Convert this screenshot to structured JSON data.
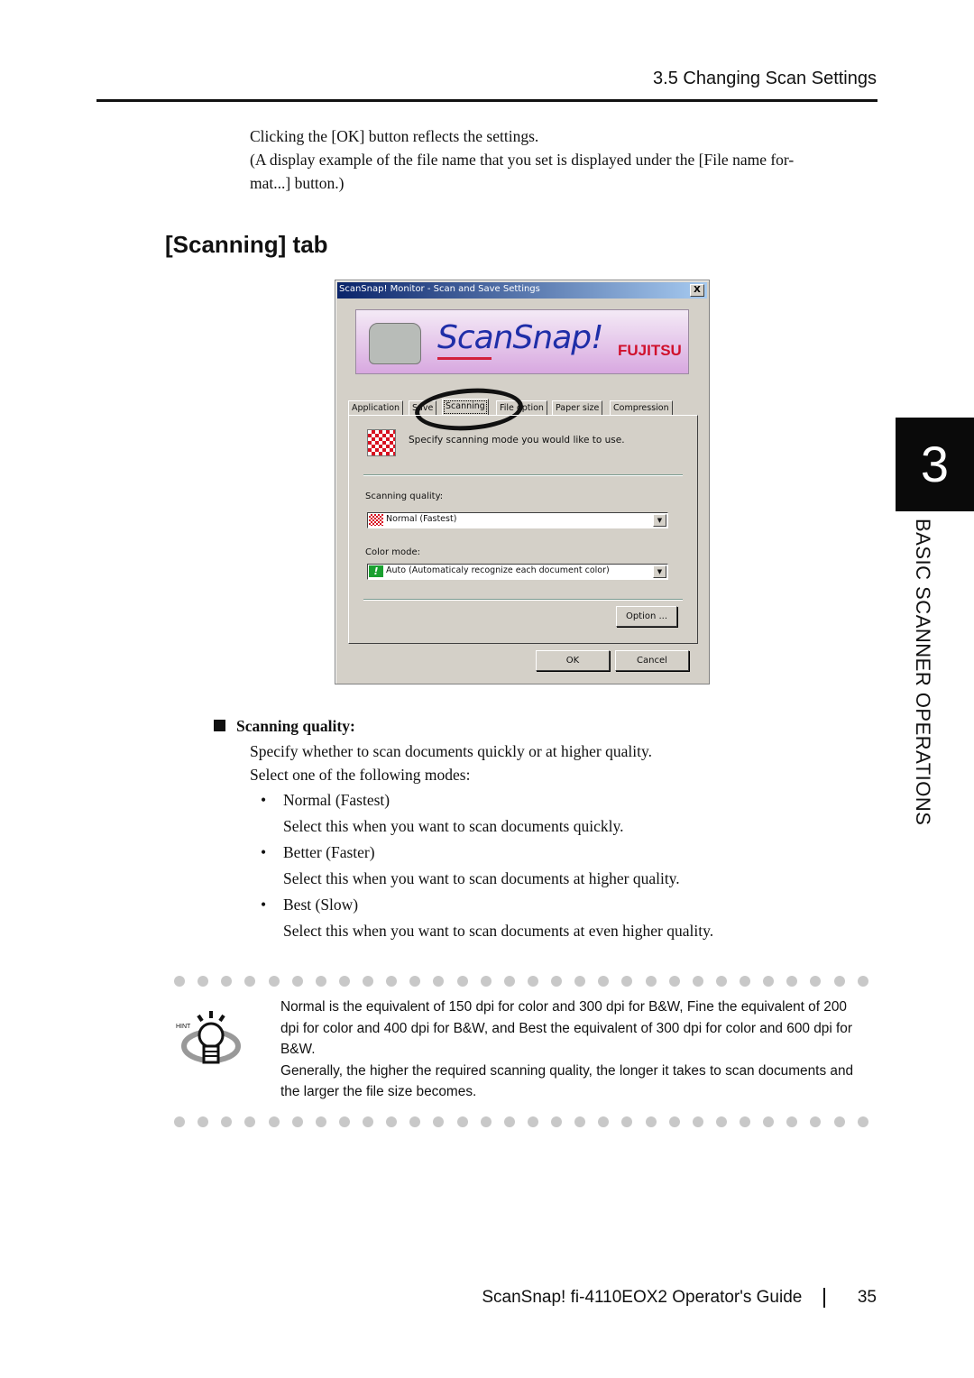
{
  "header": {
    "section_title": "3.5 Changing Scan Settings"
  },
  "intro": {
    "line1": "Clicking the [OK] button reflects the settings.",
    "line2": "(A display example of the file name that you set is displayed under the [File name for-",
    "line3": "mat...] button.)"
  },
  "section_heading": "[Scanning] tab",
  "dialog": {
    "title": "ScanSnap! Monitor - Scan and Save Settings",
    "close_label": "X",
    "banner_logo": "ScanSnap!",
    "banner_brand": "FUJITSU",
    "tabs": [
      {
        "label": "Application"
      },
      {
        "label": "Save"
      },
      {
        "label": "Scanning",
        "active": true
      },
      {
        "label": "File option"
      },
      {
        "label": "Paper size"
      },
      {
        "label": "Compression"
      }
    ],
    "panel_hint": "Specify scanning mode you would like to use.",
    "scanning_quality_label": "Scanning quality:",
    "scanning_quality_value": "Normal (Fastest)",
    "color_mode_label": "Color mode:",
    "color_mode_value": "Auto (Automaticaly recognize each document color)",
    "option_button": "Option ...",
    "ok_button": "OK",
    "cancel_button": "Cancel",
    "colors": {
      "titlebar_start": "#0a246a",
      "titlebar_end": "#a6caf0",
      "face": "#d4d0c8"
    }
  },
  "scanning_quality": {
    "heading": "Scanning quality:",
    "desc1": "Specify whether to scan documents quickly or at higher quality.",
    "desc2": "Select one of the following modes:",
    "modes": [
      {
        "name": "Normal (Fastest)",
        "desc": "Select this when you want to scan documents quickly."
      },
      {
        "name": "Better (Faster)",
        "desc": "Select this when you want to scan documents at higher quality."
      },
      {
        "name": "Best (Slow)",
        "desc": "Select this when you want to scan documents at even higher quality."
      }
    ]
  },
  "hint": {
    "label": "HINT",
    "p1": "Normal is the equivalent of 150 dpi for color and 300 dpi for B&W, Fine the equivalent of 200 dpi for color and 400 dpi for B&W, and Best the equivalent of 300 dpi for color and 600 dpi for B&W.",
    "p2": "Generally, the higher the required scanning quality, the longer it takes to scan documents and the larger the file size becomes."
  },
  "chapter": {
    "number": "3",
    "title": "BASIC SCANNER OPERATIONS"
  },
  "footer": {
    "guide_title": "ScanSnap!  fi-4110EOX2 Operator's Guide",
    "page_number": "35"
  }
}
